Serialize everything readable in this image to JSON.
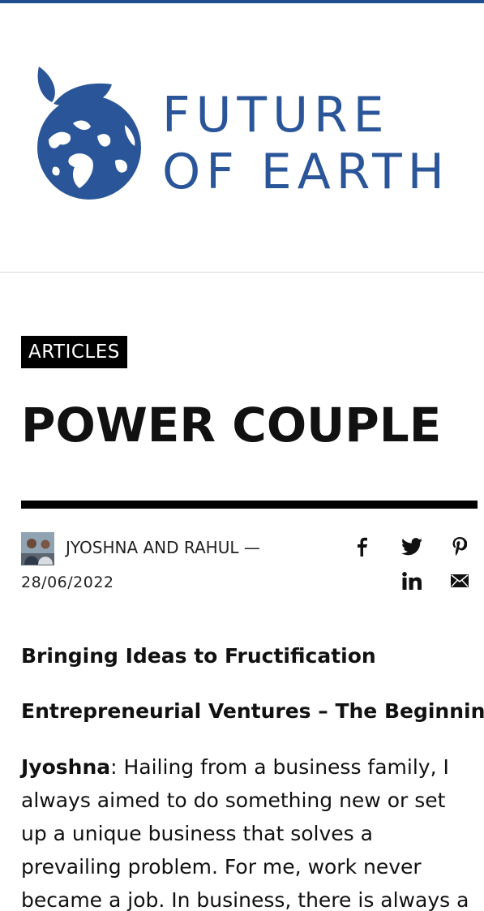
{
  "site": {
    "logo_line1": "FUTURE",
    "logo_line2": "OF EARTH",
    "brand_color": "#2a5699",
    "accent_bar_color": "#1f4e8c"
  },
  "article": {
    "category": "ARTICLES",
    "title": "POWER COUPLE",
    "author": "JYOSHNA AND RAHUL —",
    "date": "28/06/2022"
  },
  "share": {
    "icons": [
      "facebook-icon",
      "twitter-icon",
      "pinterest-icon",
      "linkedin-icon",
      "email-icon"
    ]
  },
  "body": {
    "subheading1": "Bringing Ideas to Fructification",
    "subheading2": "Entrepreneurial Ventures – The Beginning",
    "para_speaker": "Jyoshna",
    "para_text": ": Hailing from a business family, I always aimed to do something new or set up a unique business that solves a prevailing problem. For me, work never became a job. In business, there is always a"
  }
}
